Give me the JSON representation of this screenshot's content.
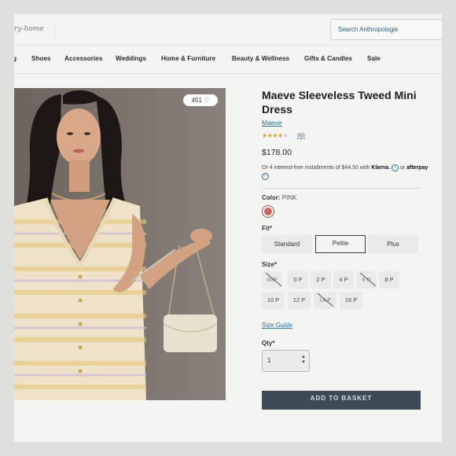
{
  "header": {
    "logo_text": "ry-home",
    "search_placeholder": "Search Anthropologie"
  },
  "nav": {
    "items": [
      {
        "label": "g"
      },
      {
        "label": "Shoes"
      },
      {
        "label": "Accessories"
      },
      {
        "label": "Weddings"
      },
      {
        "label": "Home & Furniture"
      },
      {
        "label": "Beauty & Wellness"
      },
      {
        "label": "Gifts & Candles"
      },
      {
        "label": "Sale"
      }
    ]
  },
  "product": {
    "likes_count": "451",
    "heart_icon": "heart-icon",
    "title": "Maeve Sleeveless Tweed Mini Dress",
    "brand": "Maeve",
    "rating": 4,
    "rating_max": 5,
    "review_count": "(6)",
    "price": "$178.00",
    "installments_text": "Or 4 interest-free installments of $44.50 with",
    "klarna_label": "Klarna.",
    "or_text": "or",
    "afterpay_label": "afterpay",
    "color_label": "Color:",
    "color_value": "PINK",
    "color_swatch": "#c96a60",
    "fit_label": "Fit*",
    "fit_options": [
      {
        "label": "Standard",
        "selected": false
      },
      {
        "label": "Petite",
        "selected": true
      },
      {
        "label": "Plus",
        "selected": false
      }
    ],
    "size_label": "Size*",
    "sizes": [
      {
        "label": "00P",
        "available": false
      },
      {
        "label": "0 P",
        "available": true
      },
      {
        "label": "2 P",
        "available": true
      },
      {
        "label": "4 P",
        "available": true
      },
      {
        "label": "6 P",
        "available": false
      },
      {
        "label": "8 P",
        "available": true
      },
      {
        "label": "10 P",
        "available": true
      },
      {
        "label": "12 P",
        "available": true
      },
      {
        "label": "14 P",
        "available": false
      },
      {
        "label": "16 P",
        "available": true
      }
    ],
    "size_guide": "Size Guide",
    "qty_label": "Qty*",
    "qty_value": "1",
    "add_to_basket": "ADD TO BASKET"
  },
  "colors": {
    "link": "#2a6e93",
    "star": "#d2a428",
    "button_dark": "#3e4a55"
  }
}
